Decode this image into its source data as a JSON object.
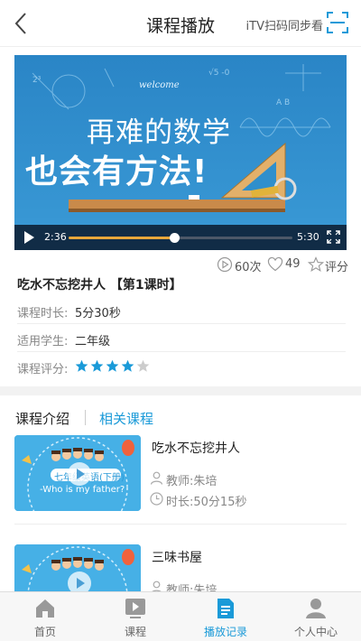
{
  "header": {
    "title": "课程播放",
    "itv_label": "iTV扫码同步看"
  },
  "video": {
    "welcome_text": "welcome",
    "headline_line1": "再难的数学",
    "headline_line2": "也会有方法!",
    "current_time": "2:36",
    "total_time": "5:30",
    "progress": 0.47
  },
  "stats": {
    "plays": "60次",
    "likes": "49",
    "rate_label": "评分"
  },
  "lesson": {
    "title": "吃水不忘挖井人 【第1课时】",
    "duration_label": "课程时长:",
    "duration_value": "5分30秒",
    "grade_label": "适用学生:",
    "grade_value": "二年级",
    "rating_label": "课程评分:",
    "rating": 4,
    "rating_max": 5
  },
  "tabs": {
    "intro": "课程介绍",
    "related": "相关课程"
  },
  "related_courses": [
    {
      "title": "吃水不忘挖井人",
      "teacher": "教师:朱培",
      "duration": "时长:50分15秒",
      "thumb_grade": "七年级英语(下册)",
      "thumb_subtitle": "-Who is my father?"
    },
    {
      "title": "三味书屋",
      "teacher": "教师:朱培"
    }
  ],
  "nav": {
    "items": [
      {
        "label": "首页",
        "icon": "home-icon"
      },
      {
        "label": "课程",
        "icon": "course-icon"
      },
      {
        "label": "播放记录",
        "icon": "history-icon"
      },
      {
        "label": "个人中心",
        "icon": "user-icon"
      }
    ],
    "active_index": 2
  },
  "colors": {
    "accent": "#1a9ad8",
    "star": "#1a9ad8",
    "progress": "#e8a73b"
  }
}
